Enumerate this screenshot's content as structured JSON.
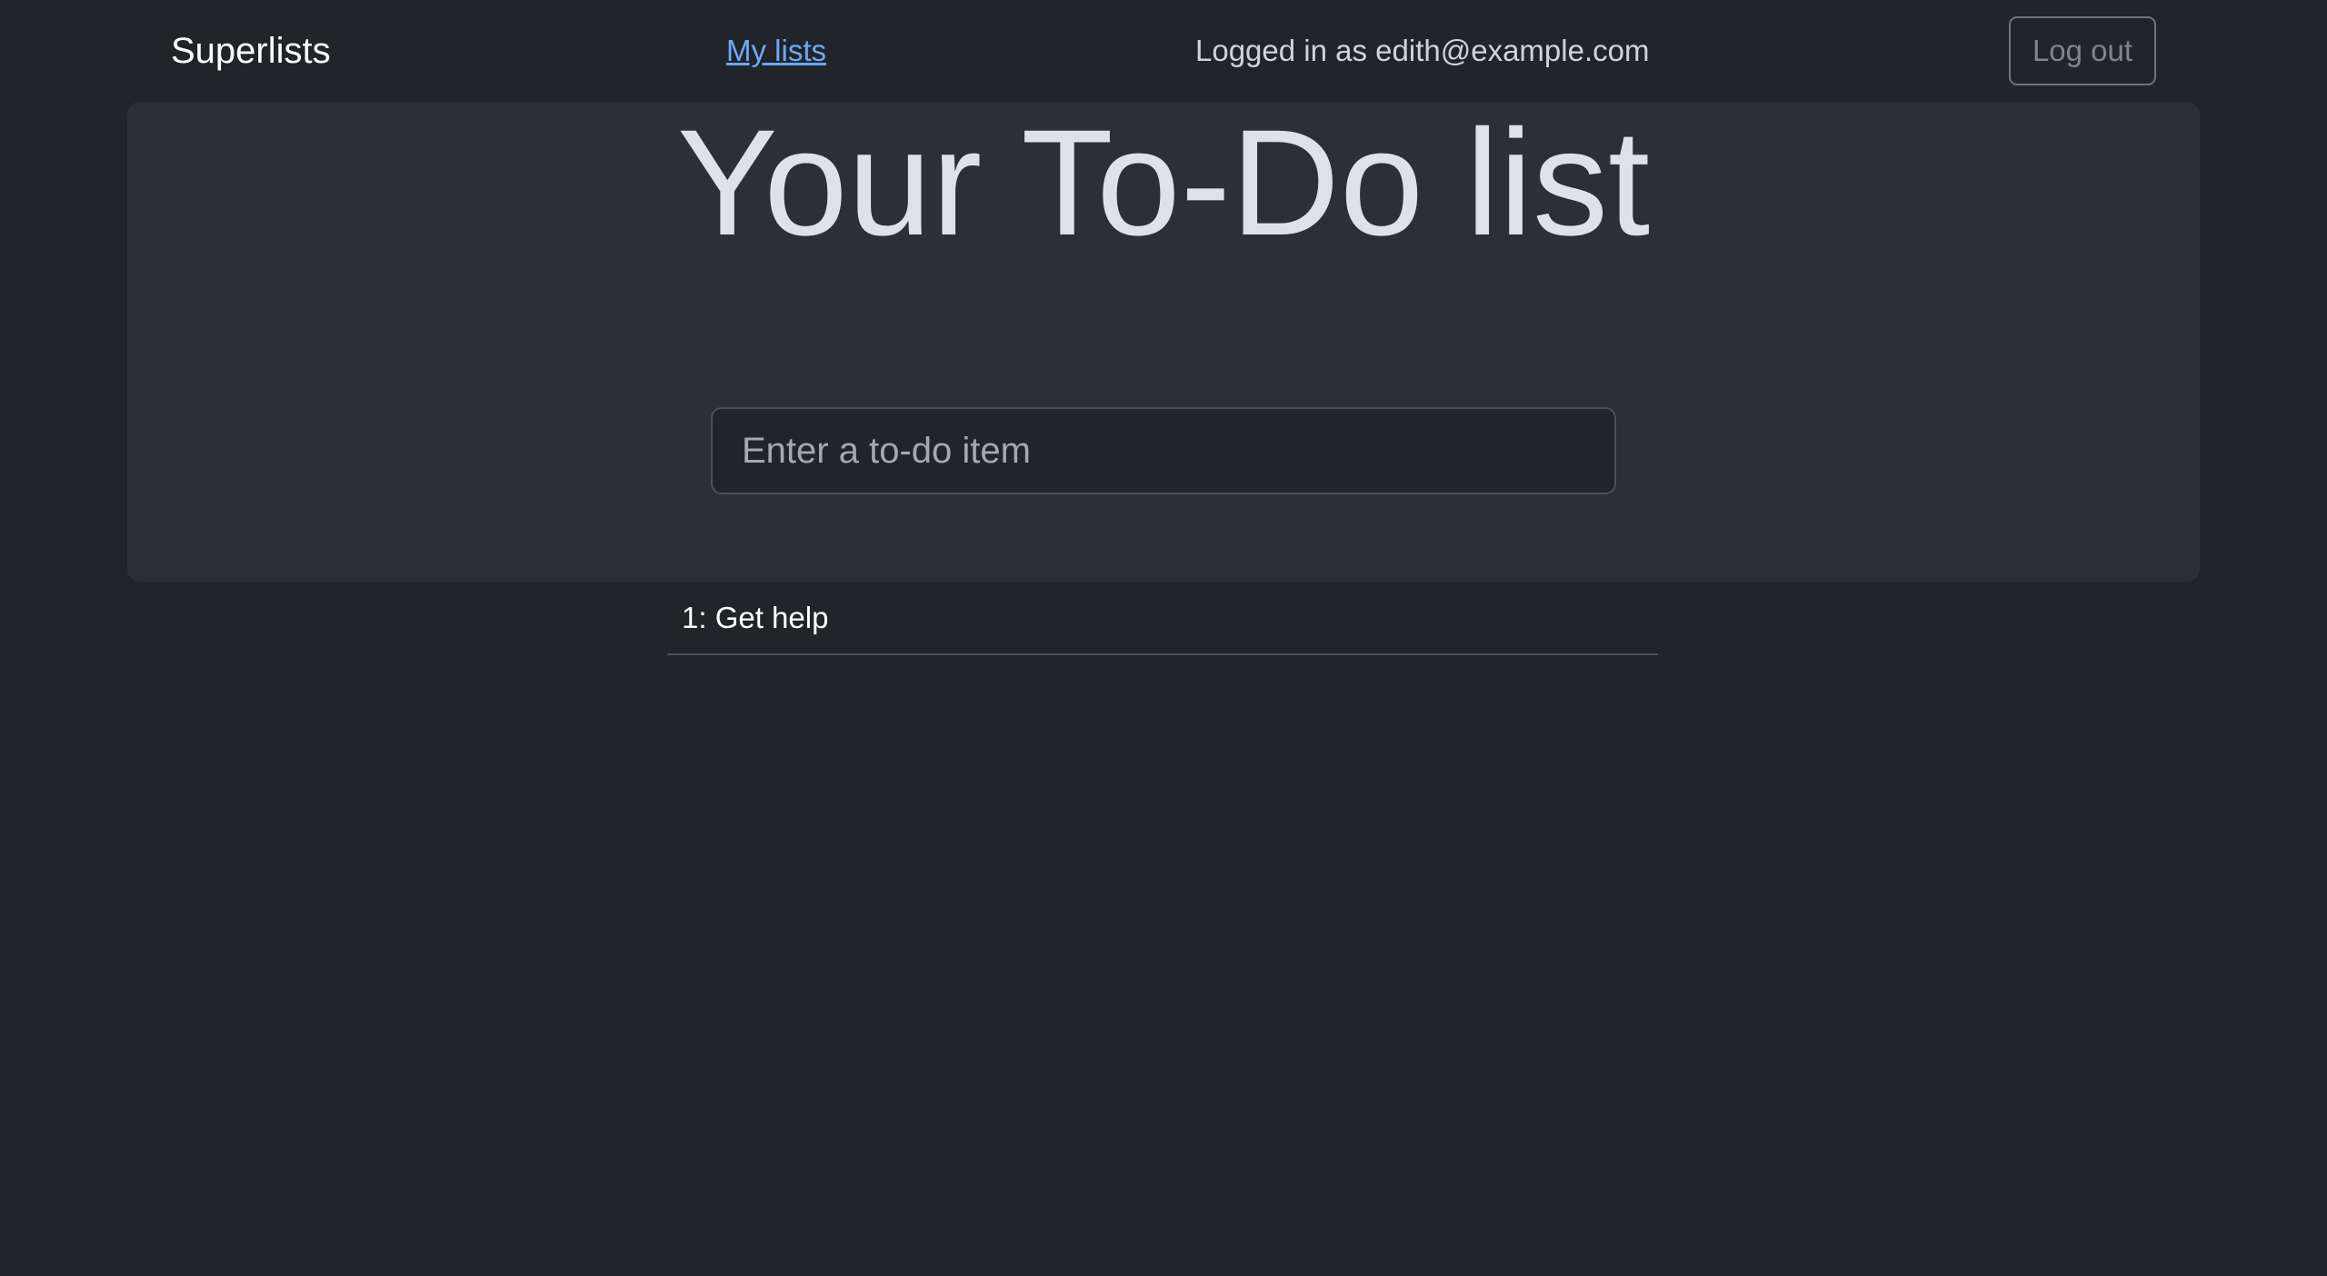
{
  "navbar": {
    "brand": "Superlists",
    "my_lists_link": "My lists",
    "logged_in_text": "Logged in as edith@example.com",
    "logout_button": "Log out"
  },
  "main": {
    "title": "Your To-Do list",
    "input": {
      "placeholder": "Enter a to-do item",
      "value": ""
    }
  },
  "list_table": {
    "rows": [
      {
        "text": "1: Get help"
      }
    ]
  },
  "colors": {
    "page_background": "#212529",
    "jumbotron_background": "#2b3035",
    "link": "#6ea8fe",
    "text_primary": "#ffffff",
    "text_muted": "#ced4da"
  }
}
